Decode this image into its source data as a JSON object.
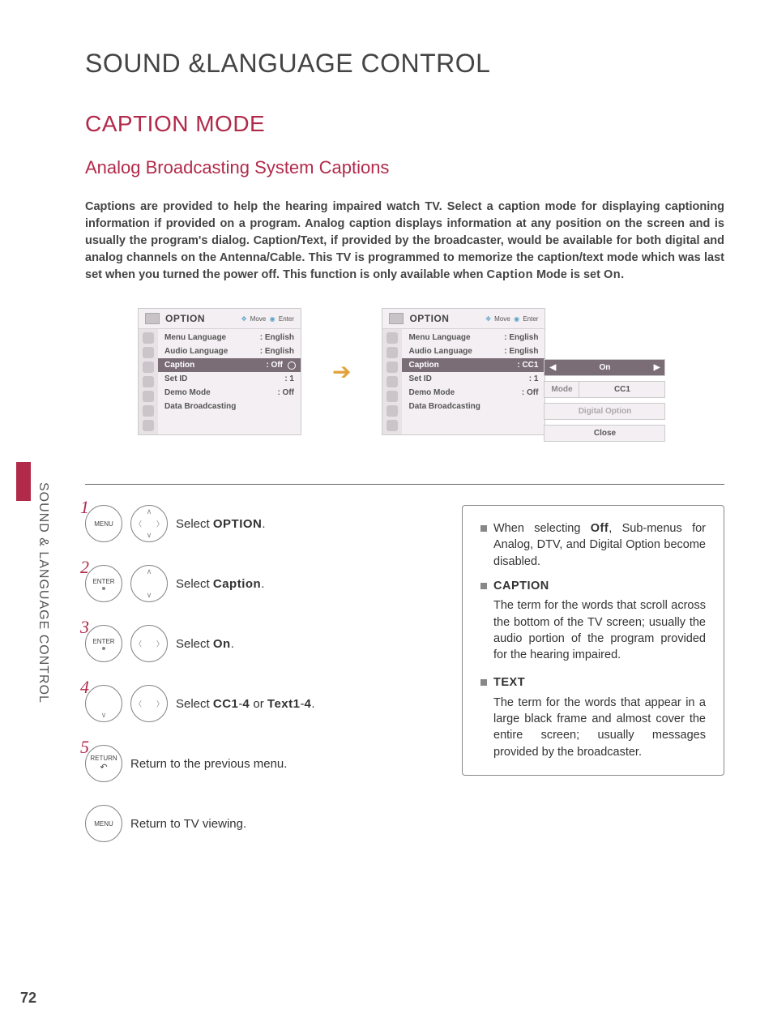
{
  "sideLabel": "SOUND & LANGUAGE CONTROL",
  "pageNumber": "72",
  "h1": "SOUND &LANGUAGE CONTROL",
  "h2": "CAPTION MODE",
  "h3": "Analog Broadcasting System Captions",
  "intro_prefix": "Captions are provided to help the hearing impaired watch TV. Select a caption mode for displaying captioning information if provided on a program. Analog caption displays information at any position on the screen and is usually the program's dialog. Caption/Text, if provided by the broadcaster, would be available for both digital and analog channels on the Antenna/Cable. This TV is programmed to memorize the caption/text mode which was last set when you turned the power off. This function is only available when ",
  "intro_bold1": "Caption",
  "intro_mid": " Mode is set ",
  "intro_bold2": "On",
  "intro_suffix": ".",
  "osd": {
    "title": "OPTION",
    "hintMove": "Move",
    "hintEnter": "Enter",
    "items": [
      {
        "label": "Menu Language",
        "value": ": English"
      },
      {
        "label": "Audio Language",
        "value": ": English"
      },
      {
        "label": "Caption",
        "valueA": ": Off",
        "valueB": ": CC1"
      },
      {
        "label": "Set ID",
        "value": ": 1"
      },
      {
        "label": "Demo Mode",
        "value": ": Off"
      },
      {
        "label": "Data Broadcasting",
        "value": ""
      }
    ]
  },
  "popup": {
    "on": "On",
    "modeLabel": "Mode",
    "modeValue": "CC1",
    "digital": "Digital Option",
    "close": "Close"
  },
  "steps": {
    "menuBtn": "MENU",
    "enterBtn": "ENTER",
    "returnBtn": "RETURN",
    "s1_a": "Select ",
    "s1_b": "OPTION",
    "s1_c": ".",
    "s2_a": "Select ",
    "s2_b": "Caption",
    "s2_c": ".",
    "s3_a": "Select ",
    "s3_b": "On",
    "s3_c": ".",
    "s4_a": "Select ",
    "s4_b": "CC1",
    "s4_c": "-",
    "s4_d": "4",
    "s4_e": " or ",
    "s4_f": "Text1",
    "s4_g": "-",
    "s4_h": "4",
    "s4_i": ".",
    "s5": "Return to the previous menu.",
    "s6": "Return to TV viewing.",
    "n1": "1",
    "n2": "2",
    "n3": "3",
    "n4": "4",
    "n5": "5"
  },
  "info": {
    "off_a": "When selecting ",
    "off_b": "Off",
    "off_c": ", Sub-menus for Analog, DTV, and Digital Option become disabled.",
    "capTitle": "CAPTION",
    "capBody": "The term for the words that scroll across the bottom of the TV screen; usually the audio portion of the program provided for the hearing impaired.",
    "txtTitle": "TEXT",
    "txtBody": "The term for the words that appear in a large black frame and almost cover the entire screen; usually messages provided by the broadcaster."
  }
}
